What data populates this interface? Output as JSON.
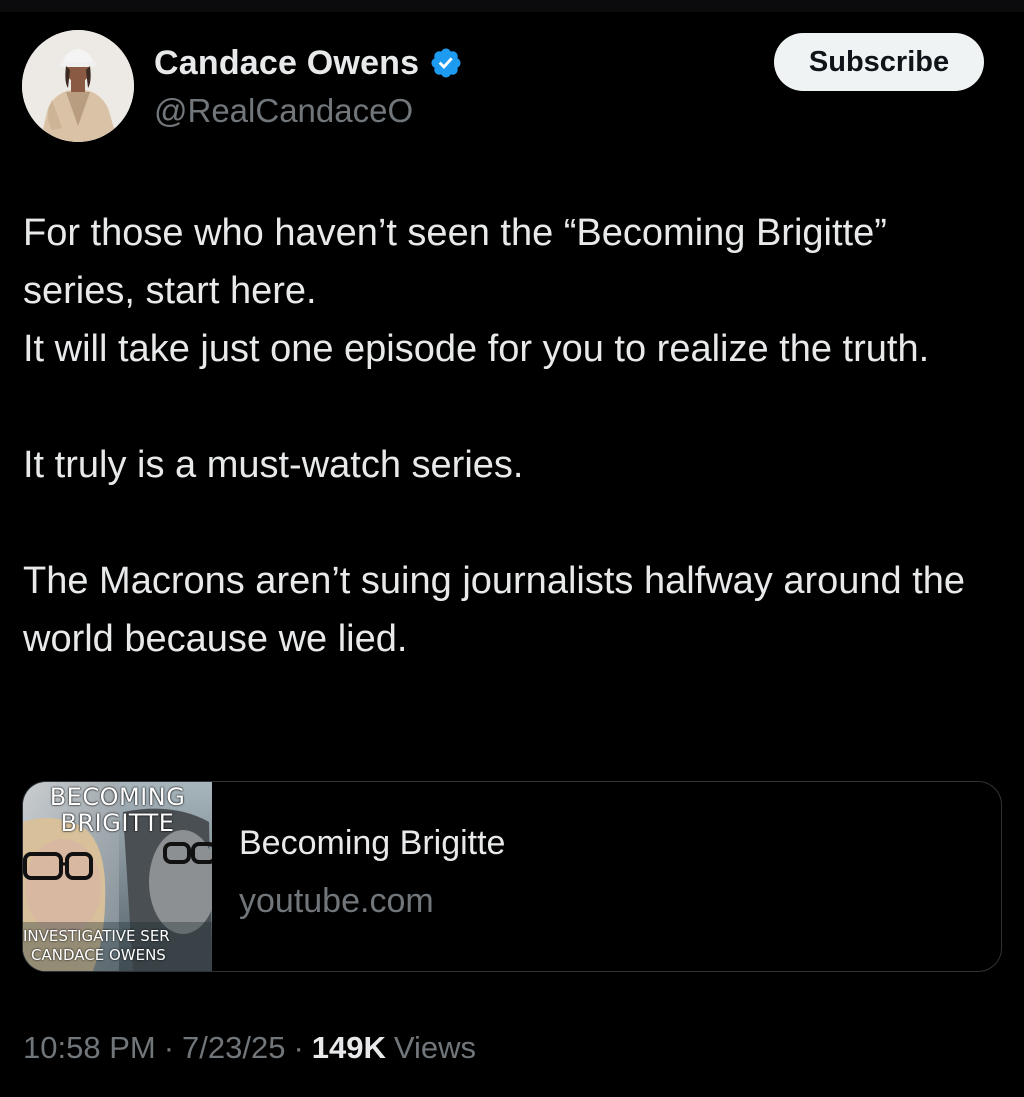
{
  "author": {
    "display_name": "Candace Owens",
    "handle": "@RealCandaceO",
    "avatar_icon": "profile-photo",
    "verified_icon": "verified-badge-icon",
    "verified_color": "#1d9bf0"
  },
  "subscribe_label": "Subscribe",
  "tweet": {
    "lines": [
      "For those who haven’t seen the “Becoming Brigitte” series, start here.",
      "It will take just one episode for you to realize the truth.",
      "It truly is a must-watch series.",
      "The Macrons aren’t suing journalists halfway around the world because we lied."
    ]
  },
  "link_card": {
    "thumbnail_title": "BECOMING BRIGITTE",
    "thumbnail_subtitle_1": "INVESTIGATIVE SER",
    "thumbnail_subtitle_2": "CANDACE OWENS",
    "title": "Becoming Brigitte",
    "domain": "youtube.com"
  },
  "meta": {
    "time": "10:58 PM",
    "date": "7/23/25",
    "views_count": "149K",
    "views_label": "Views",
    "separator": "·"
  },
  "colors": {
    "background": "#000000",
    "text_primary": "#e7e9ea",
    "text_secondary": "#71767b",
    "border": "#2f3336",
    "button_bg": "#eff3f4"
  }
}
